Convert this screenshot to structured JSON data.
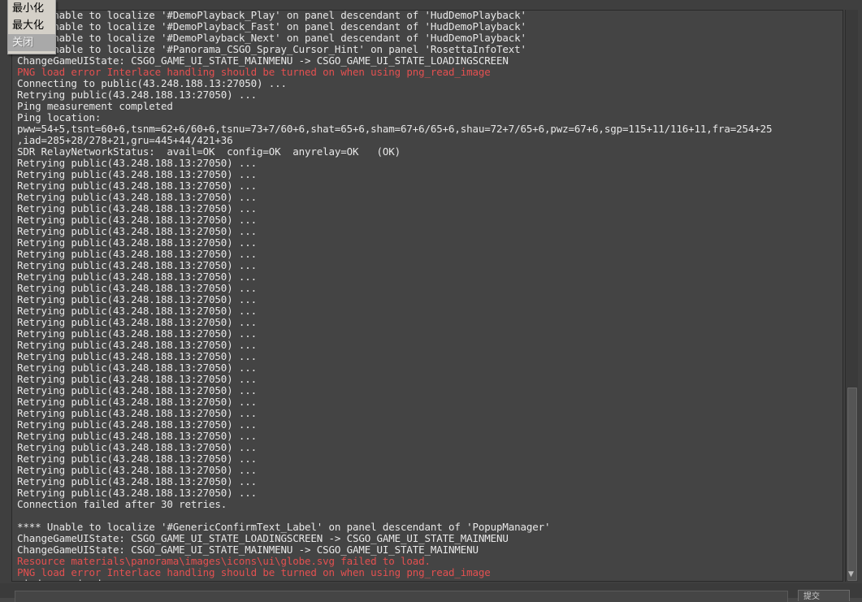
{
  "context_menu": {
    "items": [
      {
        "label": "最小化",
        "disabled": false
      },
      {
        "label": "最大化",
        "disabled": false
      },
      {
        "label": "关闭",
        "disabled": true
      }
    ]
  },
  "console": {
    "lines": [
      {
        "text": "**** Unable to localize '#DemoPlayback_Play' on panel descendant of 'HudDemoPlayback'",
        "type": "normal"
      },
      {
        "text": "**** Unable to localize '#DemoPlayback_Fast' on panel descendant of 'HudDemoPlayback'",
        "type": "normal"
      },
      {
        "text": "**** Unable to localize '#DemoPlayback_Next' on panel descendant of 'HudDemoPlayback'",
        "type": "normal"
      },
      {
        "text": "**** Unable to localize '#Panorama_CSGO_Spray_Cursor_Hint' on panel 'RosettaInfoText'",
        "type": "normal"
      },
      {
        "text": "ChangeGameUIState: CSGO_GAME_UI_STATE_MAINMENU -> CSGO_GAME_UI_STATE_LOADINGSCREEN",
        "type": "normal"
      },
      {
        "text": "PNG load error Interlace handling should be turned on when using png_read_image",
        "type": "error"
      },
      {
        "text": "Connecting to public(43.248.188.13:27050) ...",
        "type": "normal"
      },
      {
        "text": "Retrying public(43.248.188.13:27050) ...",
        "type": "normal"
      },
      {
        "text": "Ping measurement completed",
        "type": "normal"
      },
      {
        "text": "Ping location:",
        "type": "normal"
      },
      {
        "text": "pww=54+5,tsnt=60+6,tsnm=62+6/60+6,tsnu=73+7/60+6,shat=65+6,sham=67+6/65+6,shau=72+7/65+6,pwz=67+6,sgp=115+11/116+11,fra=254+25",
        "type": "normal"
      },
      {
        "text": ",iad=285+28/278+21,gru=445+44/421+36",
        "type": "normal"
      },
      {
        "text": "SDR RelayNetworkStatus:  avail=OK  config=OK  anyrelay=OK   (OK)",
        "type": "normal"
      },
      {
        "text": "Retrying public(43.248.188.13:27050) ...",
        "type": "normal"
      },
      {
        "text": "Retrying public(43.248.188.13:27050) ...",
        "type": "normal"
      },
      {
        "text": "Retrying public(43.248.188.13:27050) ...",
        "type": "normal"
      },
      {
        "text": "Retrying public(43.248.188.13:27050) ...",
        "type": "normal"
      },
      {
        "text": "Retrying public(43.248.188.13:27050) ...",
        "type": "normal"
      },
      {
        "text": "Retrying public(43.248.188.13:27050) ...",
        "type": "normal"
      },
      {
        "text": "Retrying public(43.248.188.13:27050) ...",
        "type": "normal"
      },
      {
        "text": "Retrying public(43.248.188.13:27050) ...",
        "type": "normal"
      },
      {
        "text": "Retrying public(43.248.188.13:27050) ...",
        "type": "normal"
      },
      {
        "text": "Retrying public(43.248.188.13:27050) ...",
        "type": "normal"
      },
      {
        "text": "Retrying public(43.248.188.13:27050) ...",
        "type": "normal"
      },
      {
        "text": "Retrying public(43.248.188.13:27050) ...",
        "type": "normal"
      },
      {
        "text": "Retrying public(43.248.188.13:27050) ...",
        "type": "normal"
      },
      {
        "text": "Retrying public(43.248.188.13:27050) ...",
        "type": "normal"
      },
      {
        "text": "Retrying public(43.248.188.13:27050) ...",
        "type": "normal"
      },
      {
        "text": "Retrying public(43.248.188.13:27050) ...",
        "type": "normal"
      },
      {
        "text": "Retrying public(43.248.188.13:27050) ...",
        "type": "normal"
      },
      {
        "text": "Retrying public(43.248.188.13:27050) ...",
        "type": "normal"
      },
      {
        "text": "Retrying public(43.248.188.13:27050) ...",
        "type": "normal"
      },
      {
        "text": "Retrying public(43.248.188.13:27050) ...",
        "type": "normal"
      },
      {
        "text": "Retrying public(43.248.188.13:27050) ...",
        "type": "normal"
      },
      {
        "text": "Retrying public(43.248.188.13:27050) ...",
        "type": "normal"
      },
      {
        "text": "Retrying public(43.248.188.13:27050) ...",
        "type": "normal"
      },
      {
        "text": "Retrying public(43.248.188.13:27050) ...",
        "type": "normal"
      },
      {
        "text": "Retrying public(43.248.188.13:27050) ...",
        "type": "normal"
      },
      {
        "text": "Retrying public(43.248.188.13:27050) ...",
        "type": "normal"
      },
      {
        "text": "Retrying public(43.248.188.13:27050) ...",
        "type": "normal"
      },
      {
        "text": "Retrying public(43.248.188.13:27050) ...",
        "type": "normal"
      },
      {
        "text": "Retrying public(43.248.188.13:27050) ...",
        "type": "normal"
      },
      {
        "text": "Retrying public(43.248.188.13:27050) ...",
        "type": "normal"
      },
      {
        "text": "Connection failed after 30 retries.",
        "type": "normal"
      },
      {
        "text": "",
        "type": "normal"
      },
      {
        "text": "**** Unable to localize '#GenericConfirmText_Label' on panel descendant of 'PopupManager'",
        "type": "normal"
      },
      {
        "text": "ChangeGameUIState: CSGO_GAME_UI_STATE_LOADINGSCREEN -> CSGO_GAME_UI_STATE_MAINMENU",
        "type": "normal"
      },
      {
        "text": "ChangeGameUIState: CSGO_GAME_UI_STATE_MAINMENU -> CSGO_GAME_UI_STATE_MAINMENU",
        "type": "normal"
      },
      {
        "text": "Resource materials\\panorama\\images\\icons\\ui\\globe.svg failed to load.",
        "type": "error"
      },
      {
        "text": "PNG load error Interlace handling should be turned on when using png_read_image",
        "type": "error"
      },
      {
        "text": "window resized",
        "type": "normal"
      }
    ]
  },
  "command": {
    "value": ""
  },
  "submit_button": {
    "label": "提交"
  },
  "colors": {
    "error_text": "#e35050",
    "normal_text": "#e8e8e8",
    "background": "#444444"
  }
}
